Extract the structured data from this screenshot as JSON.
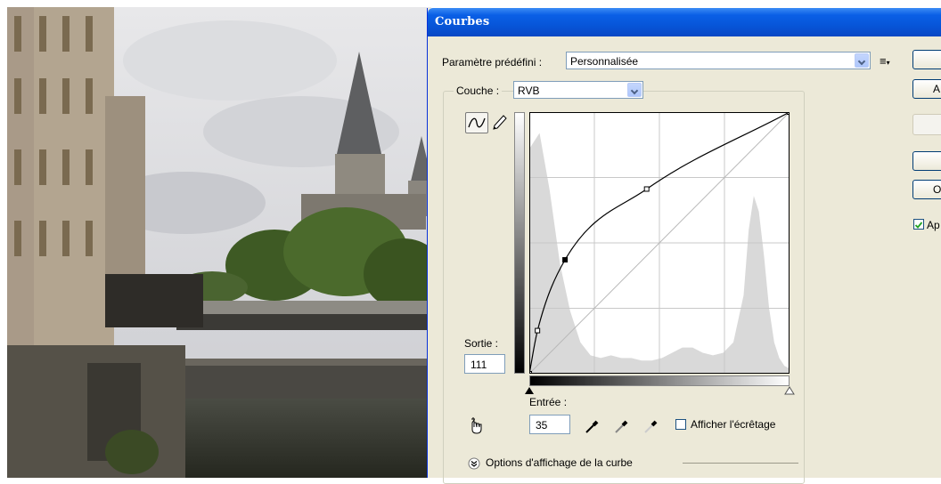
{
  "dialog": {
    "title": "Courbes",
    "preset": {
      "label": "Paramètre prédéfini :",
      "value": "Personnalisée"
    },
    "channel": {
      "label": "Couche :",
      "value": "RVB"
    },
    "output": {
      "label": "Sortie :",
      "value": "111"
    },
    "input": {
      "label": "Entrée :",
      "value": "35"
    },
    "clipping": {
      "label": "Afficher l'écrêtage",
      "checked": false
    },
    "curve_options": {
      "label": "Options d'affichage de la curbe"
    },
    "right_buttons": [
      "",
      "A",
      "",
      "",
      "O"
    ],
    "preview": {
      "label": "Ap",
      "checked": true
    }
  },
  "curve": {
    "points": [
      [
        0,
        0
      ],
      [
        8,
        42
      ],
      [
        35,
        111
      ],
      [
        115,
        180
      ],
      [
        255,
        255
      ]
    ],
    "histogram": {
      "x": [
        0,
        10,
        20,
        30,
        40,
        50,
        60,
        70,
        80,
        90,
        100,
        110,
        120,
        130,
        140,
        150,
        160,
        170,
        180,
        190,
        200,
        210,
        215,
        220,
        225,
        230,
        235,
        240,
        245,
        250,
        255
      ],
      "y": [
        0.86,
        0.92,
        0.7,
        0.42,
        0.24,
        0.12,
        0.07,
        0.06,
        0.07,
        0.06,
        0.06,
        0.05,
        0.05,
        0.06,
        0.08,
        0.1,
        0.1,
        0.08,
        0.07,
        0.08,
        0.12,
        0.3,
        0.55,
        0.68,
        0.62,
        0.45,
        0.25,
        0.12,
        0.06,
        0.03,
        0.02
      ]
    }
  },
  "colors": {
    "title_bar": "#0a5fe6",
    "dialog_bg": "#ece9d8",
    "histogram": "#d9d9d9",
    "curve": "#000000"
  }
}
